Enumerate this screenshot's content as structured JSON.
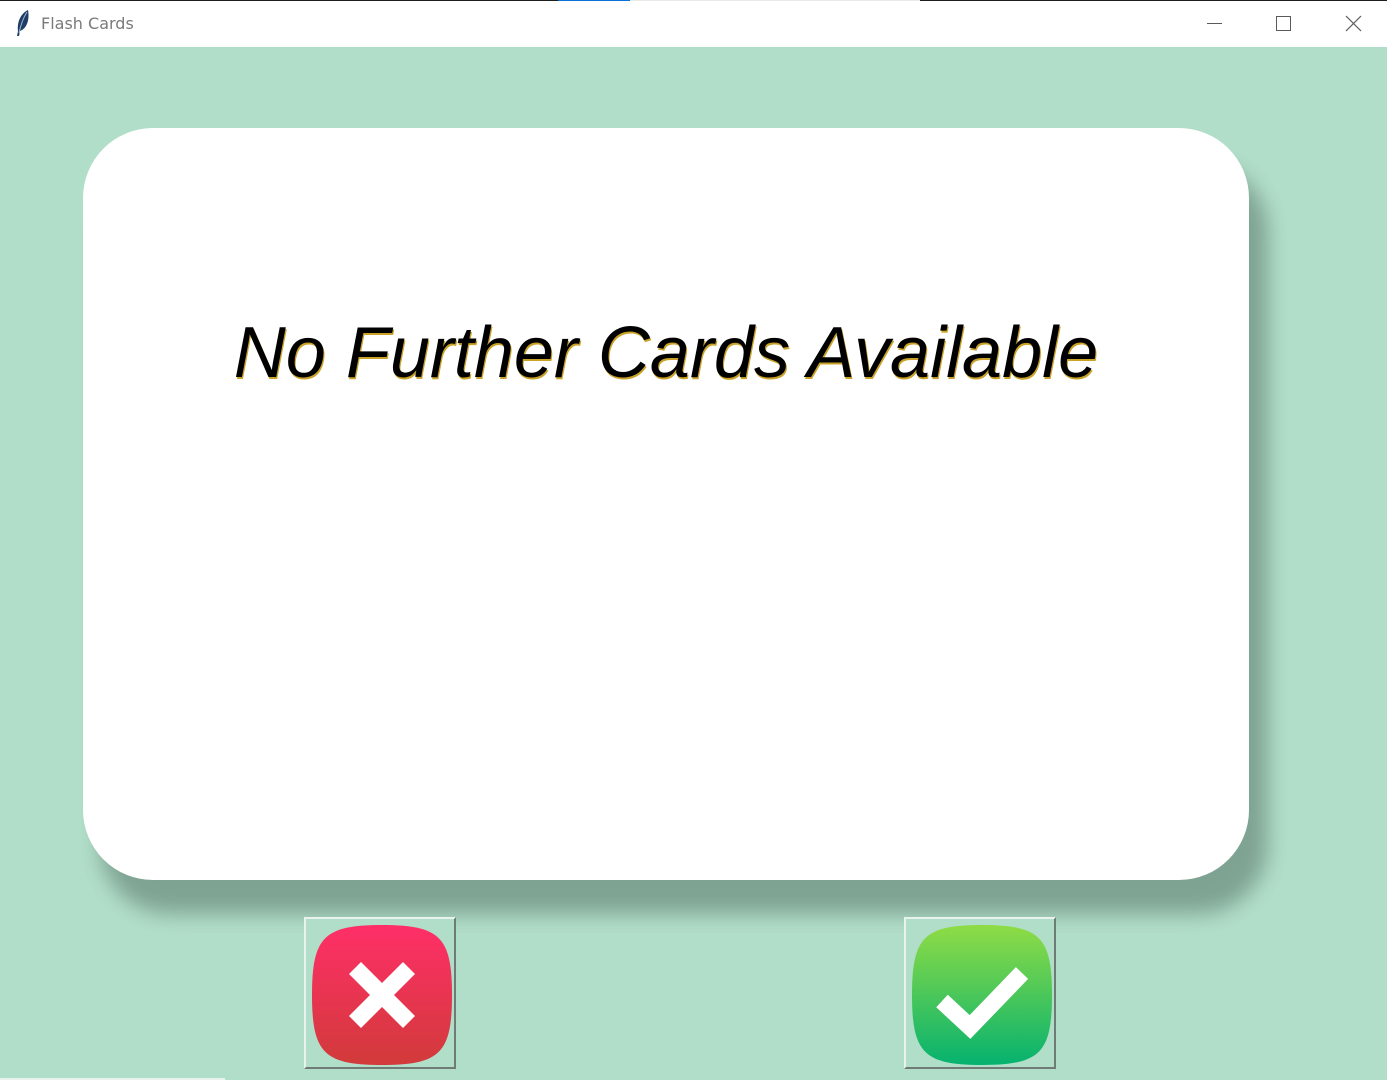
{
  "window": {
    "title": "Flash Cards",
    "controls": {
      "minimize_icon": "minimize-icon",
      "maximize_icon": "maximize-icon",
      "close_icon": "close-icon"
    }
  },
  "card": {
    "text": "No Further Cards Available"
  },
  "buttons": {
    "wrong": {
      "icon": "cross-icon",
      "color": "#e8344d"
    },
    "right": {
      "icon": "checkmark-icon",
      "color": "#3cc75a"
    }
  },
  "colors": {
    "background": "#b1dec9",
    "card": "#ffffff"
  }
}
